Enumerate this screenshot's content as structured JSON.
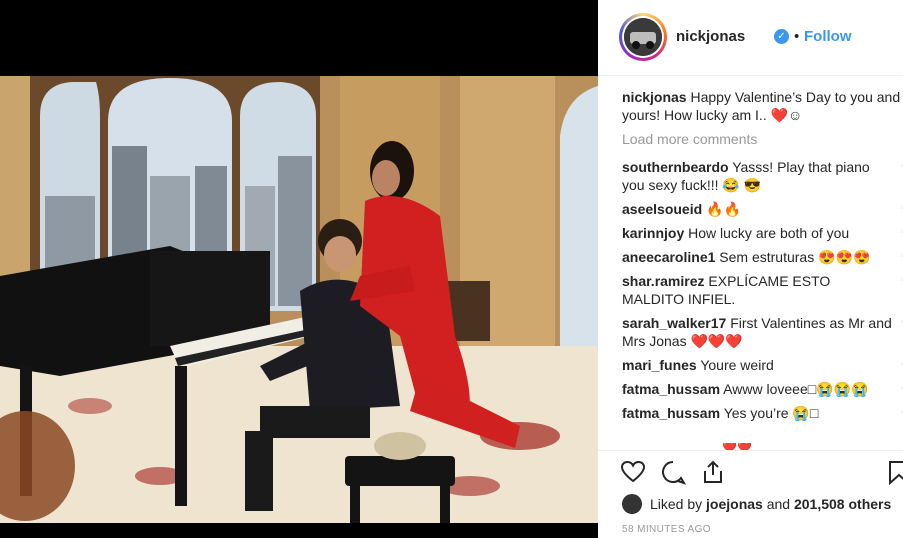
{
  "header": {
    "username": "nickjonas",
    "follow_label": "Follow",
    "separator": "•",
    "verified_glyph": "✓"
  },
  "caption": {
    "username": "nickjonas",
    "text": "Happy Valentine’s Day to you and yours! How lucky am I.. ❤️☺"
  },
  "load_more": "Load more comments",
  "comments": [
    {
      "username": "southernbeardo",
      "text": "Yasss! Play that piano you sexy fuck!!! 😂 😎"
    },
    {
      "username": "aseelsoueid",
      "text": "🔥🔥"
    },
    {
      "username": "karinnjoy",
      "text": "How lucky are both of you"
    },
    {
      "username": "aneecaroline1",
      "text": "Sem estruturas 😍😍😍"
    },
    {
      "username": "shar.ramirez",
      "text": "EXPLÍCAME ESTO MALDITO INFIEL."
    },
    {
      "username": "sarah_walker17",
      "text": "First Valentines as Mr and Mrs Jonas ❤️❤️❤️"
    },
    {
      "username": "mari_funes",
      "text": "Youre weird"
    },
    {
      "username": "fatma_hussam",
      "text": "Awww loveee□😭😭😭"
    },
    {
      "username": "fatma_hussam",
      "text": "Yes you’re 😭□"
    }
  ],
  "partial_next_comment": "❤️❤️",
  "likes": {
    "prefix": "Liked by",
    "user": "joejonas",
    "conj": "and",
    "count": "201,508 others"
  },
  "timestamp": "58 MINUTES AGO",
  "icons": {
    "like": "heart-outline-icon",
    "comment": "comment-bubble-icon",
    "share": "share-arrow-icon",
    "save": "bookmark-icon",
    "verified": "verified-badge-icon",
    "comment_like": "small-heart-icon"
  },
  "colors": {
    "link": "#3897f0",
    "text": "#262626",
    "muted": "#999999",
    "border": "#efefef"
  }
}
